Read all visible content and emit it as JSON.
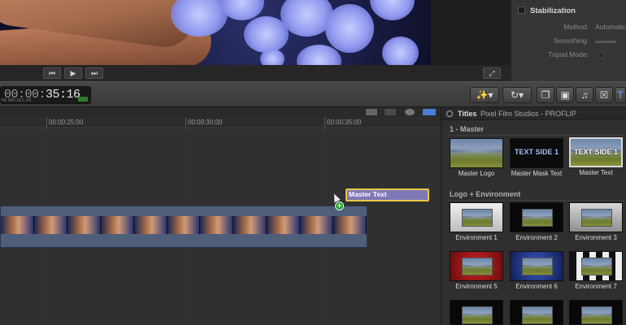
{
  "inspector": {
    "section_title": "Stabilization",
    "method_label": "Method:",
    "method_value": "Automatic",
    "smoothing_label": "Smoothing:",
    "tripod_label": "Tripod Mode:"
  },
  "timecode": {
    "dim": "00:00:",
    "bright": "35:16",
    "units": "HR  MIN  SEC  FR"
  },
  "timeline": {
    "ruler": [
      "00:00:25:00",
      "00:00:30:00",
      "00:00:35:00"
    ],
    "title_clip": "Master Text"
  },
  "browser": {
    "title": "Titles",
    "subtitle": "Pixel Film Studios - PROFLIP",
    "sections": [
      {
        "name": "1 - Master",
        "items": [
          "Master Logo",
          "Master Mask Text",
          "Master Text"
        ]
      },
      {
        "name": "Logo + Environment",
        "items": [
          "Environment 1",
          "Environment 2",
          "Environment 3",
          "Environment 5",
          "Environment 6",
          "Environment 7"
        ]
      }
    ],
    "overlay_text": "TEXT SIDE 1"
  },
  "icons": {
    "prev": "skip-back-icon",
    "play": "play-icon",
    "next": "skip-forward-icon",
    "fullscreen": "fullscreen-icon",
    "magic": "magic-wand-icon",
    "retime": "retime-icon",
    "photo": "camera-icon",
    "music": "music-note-icon",
    "transition": "transition-icon",
    "titles": "titles-icon"
  }
}
